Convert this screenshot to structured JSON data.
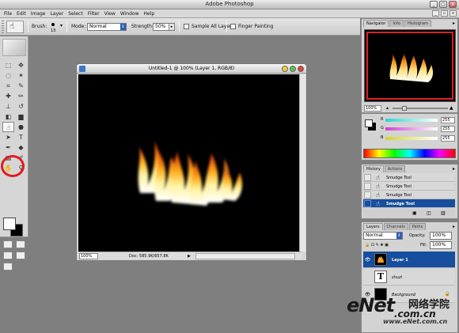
{
  "app": {
    "title": "Adobe Photoshop",
    "window_buttons": [
      "_",
      "□",
      "x"
    ]
  },
  "menu": [
    "File",
    "Edit",
    "Image",
    "Layer",
    "Select",
    "Filter",
    "View",
    "Window",
    "Help"
  ],
  "options_bar": {
    "brush_label": "Brush:",
    "brush_size": "13",
    "mode_label": "Mode:",
    "mode_value": "Normal",
    "strength_label": "Strength:",
    "strength_value": "50%",
    "sample_all_layers": "Sample All Layers",
    "finger_painting": "Finger Painting"
  },
  "document": {
    "title": "Untitled-1 @ 100% (Layer 1, RGB/8)",
    "zoom": "100%",
    "doc_info": "Doc: 585.9K/657.8K"
  },
  "navigator": {
    "tabs": [
      "Navigator",
      "Info",
      "Histogram"
    ],
    "zoom": "100%"
  },
  "color_panel": {
    "channels": [
      {
        "label": "R",
        "value": "255",
        "color": "#2fd4d4"
      },
      {
        "label": "G",
        "value": "255",
        "color": "#d43ed4"
      },
      {
        "label": "B",
        "value": "255",
        "color": "#d4d42f"
      }
    ]
  },
  "history_panel": {
    "tabs": [
      "History",
      "Actions"
    ],
    "items": [
      "Smudge Tool",
      "Smudge Tool",
      "Smudge Tool",
      "Smudge Tool"
    ],
    "selected_index": 3
  },
  "layers_panel": {
    "tabs": [
      "Layers",
      "Channels",
      "Paths"
    ],
    "blend_mode": "Normal",
    "opacity_label": "Opacity:",
    "opacity_value": "100%",
    "fill_label": "Fill:",
    "fill_value": "100%",
    "layers": [
      {
        "name": "Layer 1",
        "selected": true
      },
      {
        "name": "shuzi",
        "selected": false
      },
      {
        "name": "Background",
        "selected": false
      }
    ]
  },
  "watermark": {
    "brand": "eNet",
    "cn": "网络学院",
    "url": ".com.cn",
    "url2": "www.eNet.com.cn"
  },
  "accent_color": "#174e9e",
  "highlight_color": "#e01e1e"
}
